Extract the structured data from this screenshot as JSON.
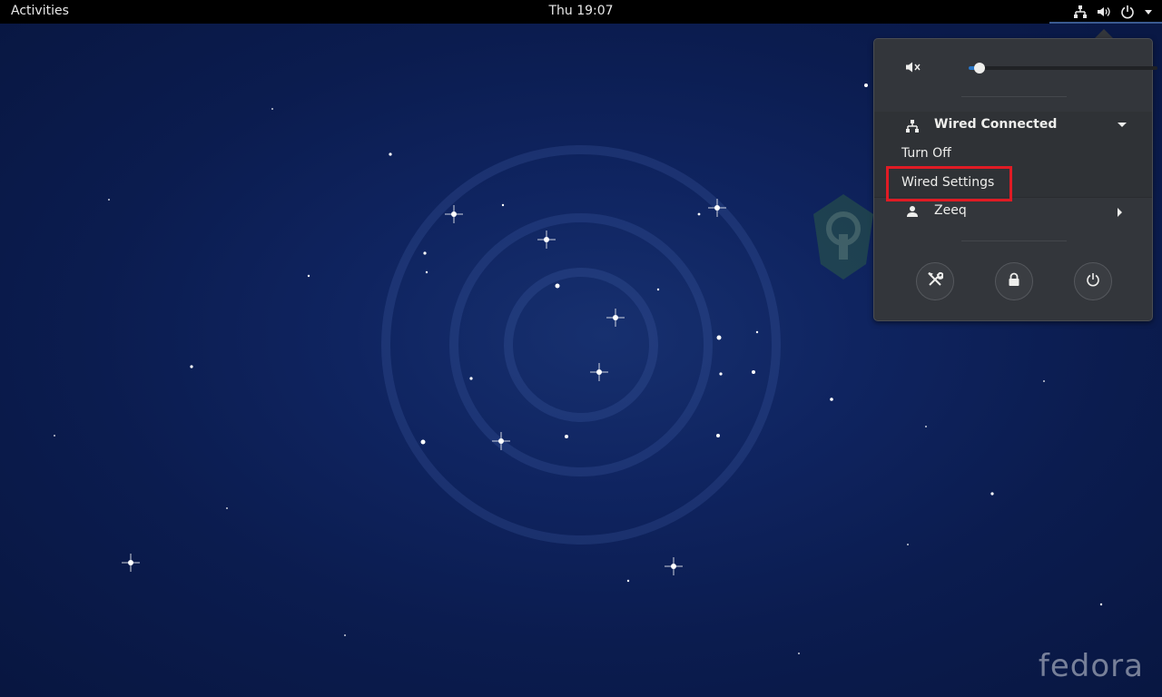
{
  "topbar": {
    "activities": "Activities",
    "clock": "Thu 19:07",
    "tray_icons": [
      "network-wired-icon",
      "volume-icon",
      "power-icon",
      "chevron-down-icon"
    ]
  },
  "system_menu": {
    "volume": {
      "icon": "speaker-muted-icon",
      "level": 0.06
    },
    "network": {
      "title": "Wired Connected",
      "icon": "network-wired-icon",
      "items": [
        "Turn Off",
        "Wired Settings"
      ]
    },
    "user": {
      "name": "Zeeq",
      "icon": "user-icon"
    },
    "actions": [
      {
        "name": "settings",
        "icon": "tools-icon"
      },
      {
        "name": "lock",
        "icon": "lock-icon"
      },
      {
        "name": "power-off",
        "icon": "power-icon"
      }
    ]
  },
  "desktop": {
    "brand": "fedora"
  },
  "colors": {
    "highlight": "#e01b24",
    "accent": "#2a76c6",
    "menu_bg": "#33363b"
  }
}
